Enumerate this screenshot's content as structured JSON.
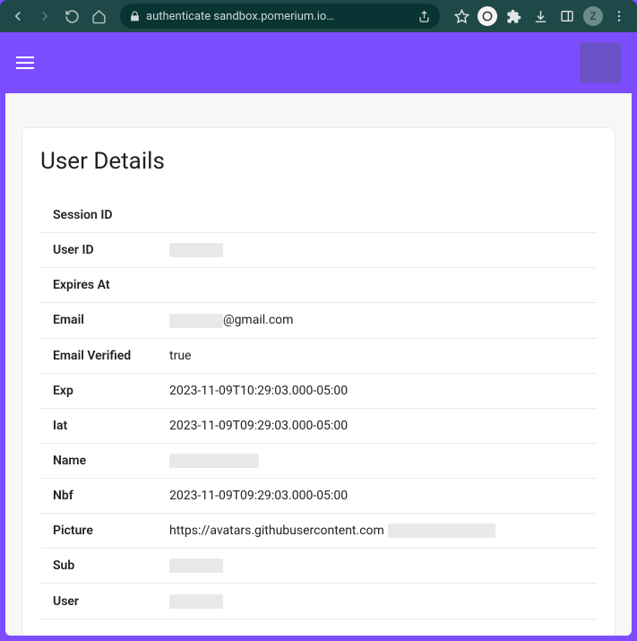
{
  "browser": {
    "url_display": "authenticate        sandbox.pomerium.io…",
    "avatar_letter": "Z"
  },
  "header": {},
  "card": {
    "title": "User Details",
    "rows": [
      {
        "label": "Session ID",
        "value": "",
        "redact": null
      },
      {
        "label": "User ID",
        "value": "",
        "redact": "sm"
      },
      {
        "label": "Expires At",
        "value": "",
        "redact": null
      },
      {
        "label": "Email",
        "value": "@gmail.com",
        "redact": "sm",
        "redact_before": true
      },
      {
        "label": "Email Verified",
        "value": "true",
        "redact": null
      },
      {
        "label": "Exp",
        "value": "2023-11-09T10:29:03.000-05:00",
        "redact": null
      },
      {
        "label": "Iat",
        "value": "2023-11-09T09:29:03.000-05:00",
        "redact": null
      },
      {
        "label": "Name",
        "value": "",
        "redact": "md"
      },
      {
        "label": "Nbf",
        "value": "2023-11-09T09:29:03.000-05:00",
        "redact": null
      },
      {
        "label": "Picture",
        "value": "https://avatars.githubusercontent.com",
        "redact": "lg",
        "redact_after": true
      },
      {
        "label": "Sub",
        "value": "",
        "redact": "sm"
      },
      {
        "label": "User",
        "value": "",
        "redact": "sm"
      }
    ]
  }
}
